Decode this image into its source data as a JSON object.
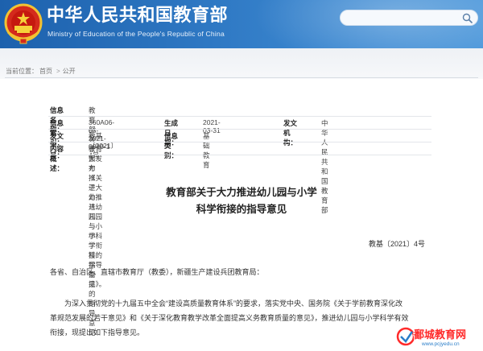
{
  "header": {
    "site_title": "中华人民共和国教育部",
    "site_subtitle": "Ministry of Education of the People's Republic of China",
    "search_placeholder": ""
  },
  "breadcrumb": {
    "prefix": "当前位置：",
    "home": "首页",
    "separator": ">",
    "current": "公开"
  },
  "info": {
    "info_name_label": "信息名称：",
    "info_name_value": "教育部关于大力推进幼儿园与小学科学衔接的指导意见",
    "index_label": "信息索引：",
    "index_value": "360A06-05-2021-0010-1",
    "date_label": "生成日期：",
    "date_value": "2021-03-31",
    "issuer_label": "发文机构：",
    "issuer_value": "中华人民共和国教育部",
    "doc_label": "发文字号：",
    "doc_value": "教基〔2021〕4号",
    "category_label": "信息类别：",
    "category_value": "基础教育",
    "summary_label": "内容概述：",
    "summary_value": "教育部发布《关于大力推进幼儿园与小学科学衔接的指导意见》。"
  },
  "article": {
    "title_line1": "教育部关于大力推进幼儿园与小学",
    "title_line2": "科学衔接的指导意见",
    "doc_number": "教基〔2021〕4号",
    "salutation": "各省、自治区、直辖市教育厅（教委），新疆生产建设兵团教育局：",
    "para1_line1": "为深入贯彻党的十九届五中全会“建设高质量教育体系”的要求，落实党中央、国务院《关于学前教育深化改",
    "para1_line2": "革规范发展的若干意见》和《关于深化教育教学改革全面提高义务教育质量的意见》，推进幼儿园与小学科学有效",
    "para1_line3": "衔接，现提出如下指导意见。"
  },
  "watermark": {
    "text": "鄱城教育网",
    "url": "www.pcjyedu.cn"
  },
  "colors": {
    "banner_dark": "#1d61ad",
    "banner_light": "#4c97da",
    "watermark_red": "#ff2a2a"
  },
  "icons": {
    "emblem": "national-emblem-icon",
    "search": "search-icon"
  }
}
